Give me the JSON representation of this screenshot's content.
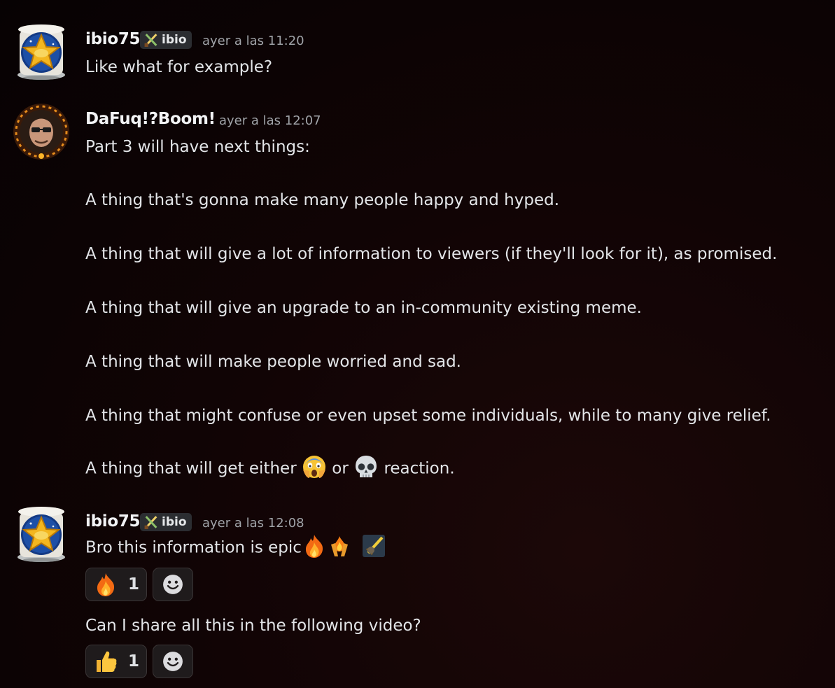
{
  "messages": [
    {
      "author": "ibio75",
      "tag": "ibio",
      "time": "ayer a las 11:20",
      "lines": [
        "Like what for example?"
      ]
    },
    {
      "author": "DaFuq!?Boom!",
      "time": "ayer a las 12:07",
      "lines": [
        "Part 3 will have next things:",
        "A thing that's gonna make many people happy and hyped.",
        "A thing that will give a lot of information to viewers (if they'll look for it), as promised.",
        "A thing that will give an upgrade to an in-community existing meme.",
        "A thing that will make people worried and sad.",
        "A thing that might confuse or even upset some individuals, while to many give relief.",
        "A thing that will get either",
        "or",
        "reaction."
      ]
    },
    {
      "author": "ibio75",
      "tag": "ibio",
      "time": "ayer a las 12:08",
      "lines": [
        "Bro this information is epic",
        "Can I share all this in the following video?"
      ],
      "reactions": [
        {
          "emoji": "fire-emoji",
          "count": "1"
        },
        {
          "emoji": "thumbs-up-emoji",
          "count": "1"
        }
      ]
    }
  ],
  "icons": {
    "tag_icon": "crossed-swords-icon",
    "add_reaction": "smiley-add-reaction-icon",
    "inline_emojis": [
      "scream-emoji",
      "skull-emoji",
      "fire-emoji",
      "fire-hands-emoji",
      "sword-sticker-emoji"
    ]
  },
  "colors": {
    "background": "#0b0304",
    "username": "#f2f3f5",
    "text": "#e3e5e8",
    "timestamp": "#a0a3a8",
    "tag_bg": "#2b2d31"
  }
}
